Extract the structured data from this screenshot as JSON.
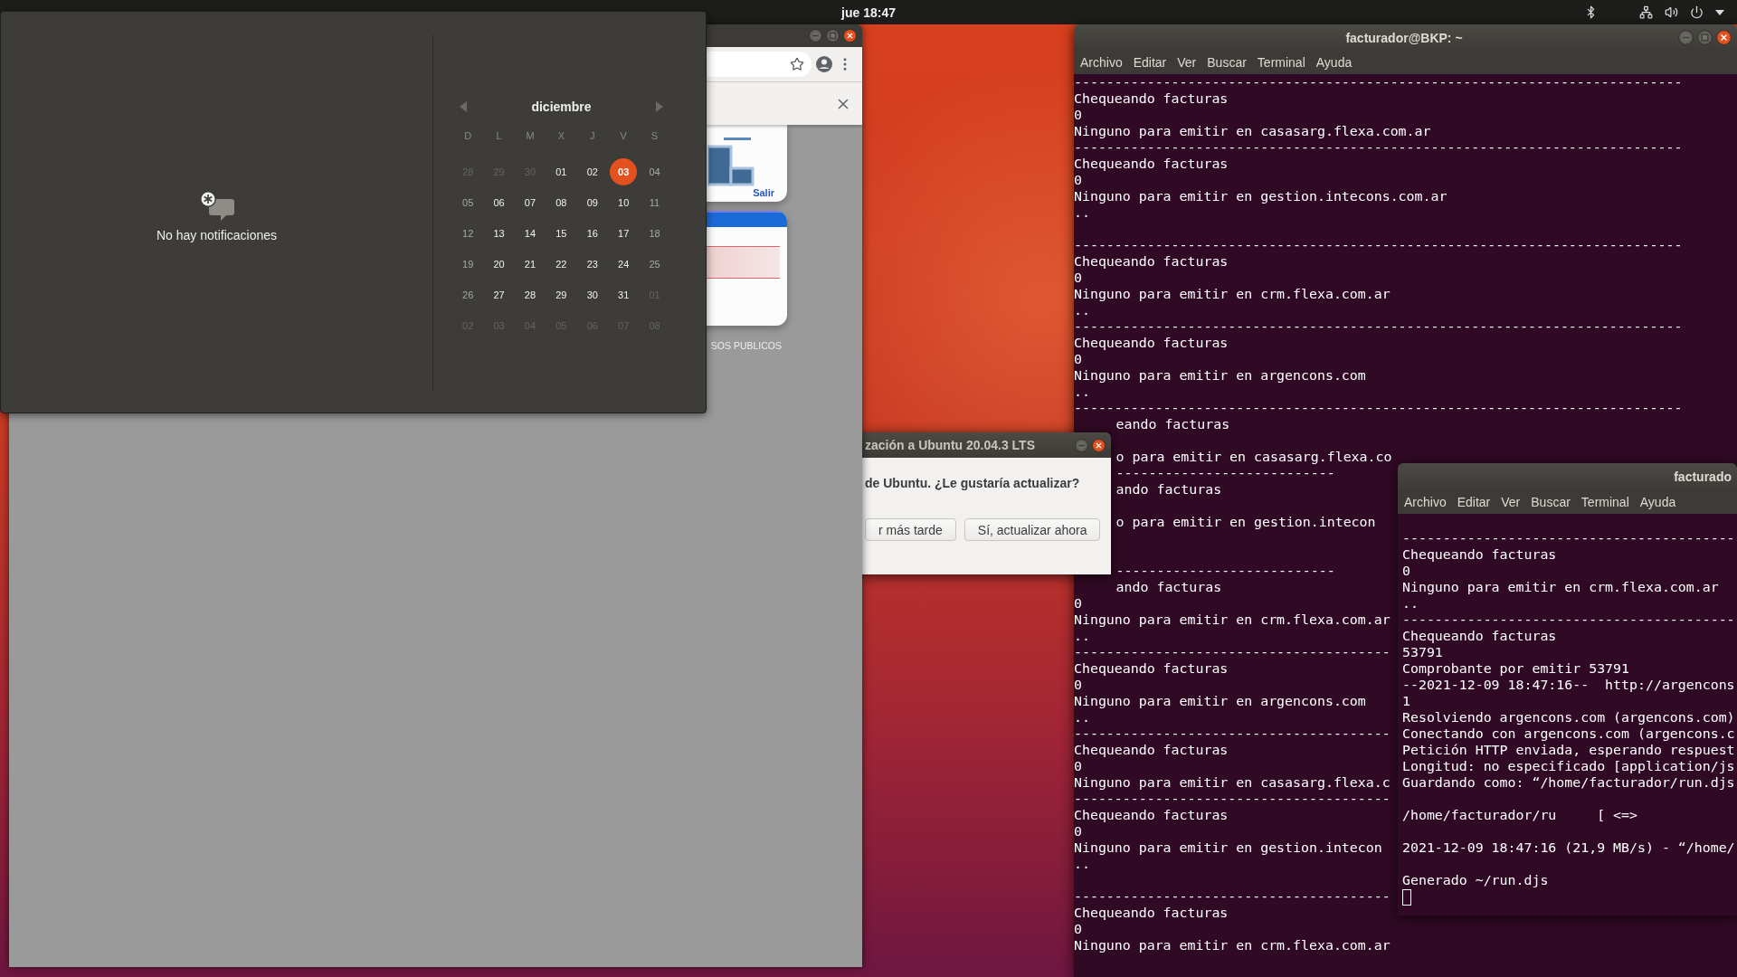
{
  "top_bar": {
    "clock": "jue 18:47"
  },
  "notifications": {
    "empty_text": "No hay notificaciones"
  },
  "calendar": {
    "month": "diciembre",
    "weekdays": [
      "D",
      "L",
      "M",
      "X",
      "J",
      "V",
      "S"
    ],
    "weeks": [
      [
        {
          "day": "28",
          "kind": "other"
        },
        {
          "day": "29",
          "kind": "other"
        },
        {
          "day": "30",
          "kind": "other"
        },
        {
          "day": "01",
          "kind": "weekday"
        },
        {
          "day": "02",
          "kind": "weekday"
        },
        {
          "day": "03",
          "kind": "today"
        },
        {
          "day": "04",
          "kind": "weekend"
        }
      ],
      [
        {
          "day": "05",
          "kind": "weekend"
        },
        {
          "day": "06",
          "kind": "weekday"
        },
        {
          "day": "07",
          "kind": "weekday"
        },
        {
          "day": "08",
          "kind": "weekday"
        },
        {
          "day": "09",
          "kind": "weekday"
        },
        {
          "day": "10",
          "kind": "weekday"
        },
        {
          "day": "11",
          "kind": "weekend"
        }
      ],
      [
        {
          "day": "12",
          "kind": "weekend"
        },
        {
          "day": "13",
          "kind": "weekday"
        },
        {
          "day": "14",
          "kind": "weekday"
        },
        {
          "day": "15",
          "kind": "weekday"
        },
        {
          "day": "16",
          "kind": "weekday"
        },
        {
          "day": "17",
          "kind": "weekday"
        },
        {
          "day": "18",
          "kind": "weekend"
        }
      ],
      [
        {
          "day": "19",
          "kind": "weekend"
        },
        {
          "day": "20",
          "kind": "weekday"
        },
        {
          "day": "21",
          "kind": "weekday"
        },
        {
          "day": "22",
          "kind": "weekday"
        },
        {
          "day": "23",
          "kind": "weekday"
        },
        {
          "day": "24",
          "kind": "weekday"
        },
        {
          "day": "25",
          "kind": "weekend"
        }
      ],
      [
        {
          "day": "26",
          "kind": "weekend"
        },
        {
          "day": "27",
          "kind": "weekday"
        },
        {
          "day": "28",
          "kind": "weekday"
        },
        {
          "day": "29",
          "kind": "weekday"
        },
        {
          "day": "30",
          "kind": "weekday"
        },
        {
          "day": "31",
          "kind": "weekday"
        },
        {
          "day": "01",
          "kind": "other"
        }
      ],
      [
        {
          "day": "02",
          "kind": "other"
        },
        {
          "day": "03",
          "kind": "other"
        },
        {
          "day": "04",
          "kind": "other"
        },
        {
          "day": "05",
          "kind": "other"
        },
        {
          "day": "06",
          "kind": "other"
        },
        {
          "day": "07",
          "kind": "other"
        },
        {
          "day": "08",
          "kind": "other"
        }
      ]
    ]
  },
  "browser": {
    "link": "Salir",
    "section_text": "SOS PUBLICOS"
  },
  "update_dialog": {
    "title": "zación a Ubuntu 20.04.3 LTS",
    "message": "de Ubuntu. ¿Le gustaría actualizar?",
    "buttons": [
      "r más tarde",
      "Sí, actualizar ahora"
    ]
  },
  "terminals": [
    {
      "title": "facturador@BKP: ~",
      "menu": [
        "Archivo",
        "Editar",
        "Ver",
        "Buscar",
        "Terminal",
        "Ayuda"
      ],
      "lines": [
        {
          "kind": "text",
          "text": "---------------------------------------------------------------------------"
        },
        {
          "kind": "text",
          "text": "Chequeando facturas"
        },
        {
          "kind": "text",
          "text": "0"
        },
        {
          "kind": "text",
          "text": "Ninguno para emitir en casasarg.flexa.com.ar"
        },
        {
          "kind": "text",
          "text": "---------------------------------------------------------------------------"
        },
        {
          "kind": "text",
          "text": "Chequeando facturas"
        },
        {
          "kind": "text",
          "text": "0"
        },
        {
          "kind": "text",
          "text": "Ninguno para emitir en gestion.intecons.com.ar"
        },
        {
          "kind": "text",
          "text": ".."
        },
        {
          "kind": "blank"
        },
        {
          "kind": "text",
          "text": "---------------------------------------------------------------------------"
        },
        {
          "kind": "text",
          "text": "Chequeando facturas"
        },
        {
          "kind": "text",
          "text": "0"
        },
        {
          "kind": "text",
          "text": "Ninguno para emitir en crm.flexa.com.ar"
        },
        {
          "kind": "text",
          "text": ".."
        },
        {
          "kind": "text",
          "text": "---------------------------------------------------------------------------"
        },
        {
          "kind": "text",
          "text": "Chequeando facturas"
        },
        {
          "kind": "text",
          "text": "0"
        },
        {
          "kind": "text",
          "text": "Ninguno para emitir en argencons.com"
        },
        {
          "kind": "text",
          "text": ".."
        },
        {
          "kind": "text",
          "text": "---------------------------------------------------------------------------"
        },
        {
          "kind": "clipped",
          "text": "eando facturas"
        },
        {
          "kind": "blank"
        },
        {
          "kind": "clipped",
          "text": "o para emitir en casasarg.flexa.co"
        },
        {
          "kind": "clipped",
          "text": "---------------------------"
        },
        {
          "kind": "clipped",
          "text": "ando facturas"
        },
        {
          "kind": "blank"
        },
        {
          "kind": "clipped",
          "text": "o para emitir en gestion.intecon"
        },
        {
          "kind": "blank"
        },
        {
          "kind": "blank"
        },
        {
          "kind": "clipped",
          "text": "---------------------------"
        },
        {
          "kind": "clipped",
          "text": "ando facturas"
        },
        {
          "kind": "text",
          "text": "0"
        },
        {
          "kind": "text",
          "text": "Ninguno para emitir en crm.flexa.com.ar"
        },
        {
          "kind": "text",
          "text": ".."
        },
        {
          "kind": "text",
          "text": "---------------------------------------"
        },
        {
          "kind": "text",
          "text": "Chequeando facturas"
        },
        {
          "kind": "text",
          "text": "0"
        },
        {
          "kind": "text",
          "text": "Ninguno para emitir en argencons.com"
        },
        {
          "kind": "text",
          "text": ".."
        },
        {
          "kind": "text",
          "text": "---------------------------------------"
        },
        {
          "kind": "text",
          "text": "Chequeando facturas"
        },
        {
          "kind": "text",
          "text": "0"
        },
        {
          "kind": "text",
          "text": "Ninguno para emitir en casasarg.flexa.c"
        },
        {
          "kind": "text",
          "text": "---------------------------------------"
        },
        {
          "kind": "text",
          "text": "Chequeando facturas"
        },
        {
          "kind": "text",
          "text": "0"
        },
        {
          "kind": "text",
          "text": "Ninguno para emitir en gestion.intecon"
        },
        {
          "kind": "text",
          "text": ".."
        },
        {
          "kind": "blank"
        },
        {
          "kind": "text",
          "text": "---------------------------------------"
        },
        {
          "kind": "text",
          "text": "Chequeando facturas"
        },
        {
          "kind": "text",
          "text": "0"
        },
        {
          "kind": "text",
          "text": "Ninguno para emitir en crm.flexa.com.ar"
        }
      ]
    },
    {
      "title": "facturado",
      "menu": [
        "Archivo",
        "Editar",
        "Ver",
        "Buscar",
        "Terminal",
        "Ayuda"
      ],
      "lines": [
        {
          "kind": "blank"
        },
        {
          "kind": "text",
          "text": "-----------------------------------------"
        },
        {
          "kind": "text",
          "text": "Chequeando facturas"
        },
        {
          "kind": "text",
          "text": "0"
        },
        {
          "kind": "text",
          "text": "Ninguno para emitir en crm.flexa.com.ar"
        },
        {
          "kind": "text",
          "text": ".."
        },
        {
          "kind": "text",
          "text": "-----------------------------------------"
        },
        {
          "kind": "text",
          "text": "Chequeando facturas"
        },
        {
          "kind": "text",
          "text": "53791"
        },
        {
          "kind": "text",
          "text": "Comprobante por emitir 53791"
        },
        {
          "kind": "text",
          "text": "--2021-12-09 18:47:16--  http://argencons"
        },
        {
          "kind": "text",
          "text": "1"
        },
        {
          "kind": "text",
          "text": "Resolviendo argencons.com (argencons.com)"
        },
        {
          "kind": "text",
          "text": "Conectando con argencons.com (argencons.c"
        },
        {
          "kind": "text",
          "text": "Petición HTTP enviada, esperando respuest"
        },
        {
          "kind": "text",
          "text": "Longitud: no especificado [application/js"
        },
        {
          "kind": "text",
          "text": "Guardando como: “/home/facturador/run.djs"
        },
        {
          "kind": "blank"
        },
        {
          "kind": "text",
          "text": "/home/facturador/ru     [ <=>"
        },
        {
          "kind": "blank"
        },
        {
          "kind": "text",
          "text": "2021-12-09 18:47:16 (21,9 MB/s) - “/home/"
        },
        {
          "kind": "blank"
        },
        {
          "kind": "text",
          "text": "Generado ~/run.djs"
        },
        {
          "kind": "cursor"
        }
      ]
    }
  ]
}
